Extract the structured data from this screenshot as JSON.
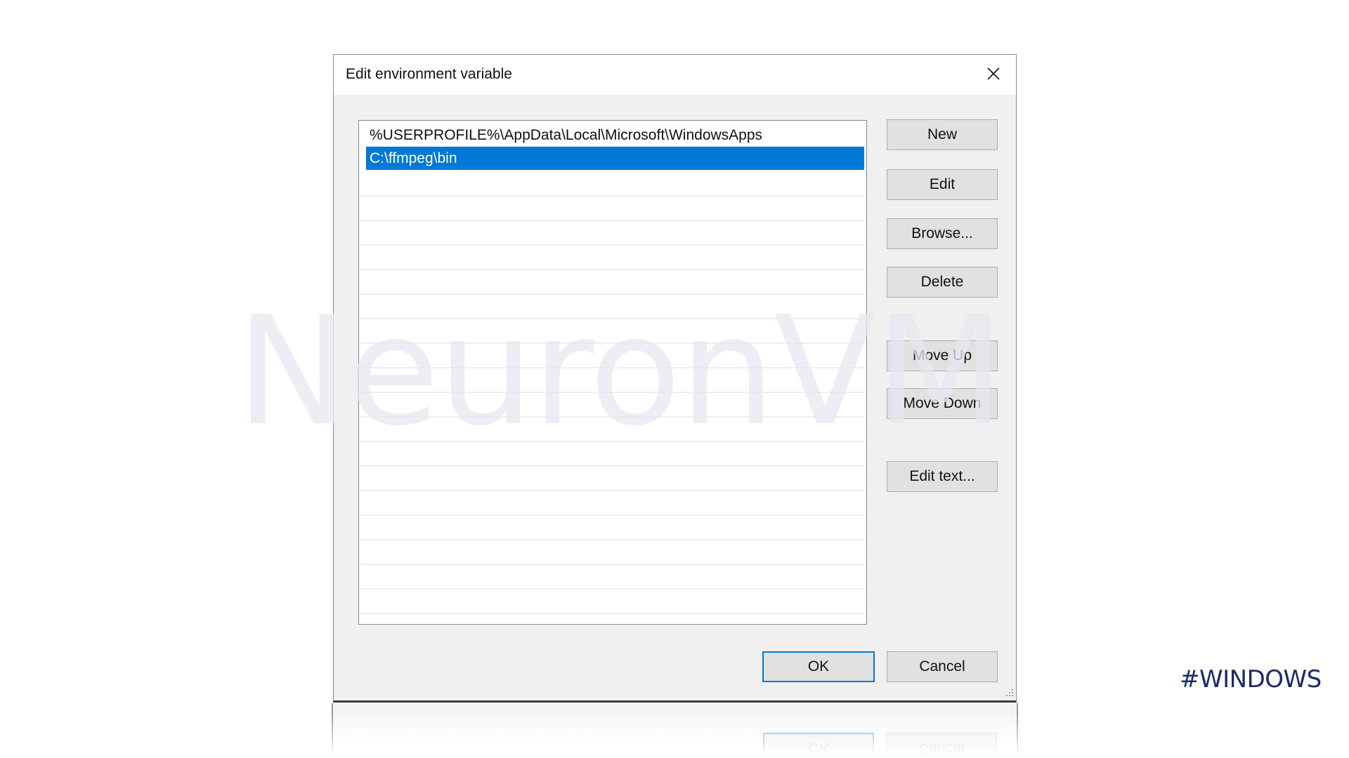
{
  "dialog": {
    "title": "Edit environment variable",
    "close_icon": "close-icon",
    "list_items": [
      {
        "label": "%USERPROFILE%\\AppData\\Local\\Microsoft\\WindowsApps",
        "selected": false
      },
      {
        "label": "C:\\ffmpeg\\bin",
        "selected": true
      }
    ],
    "side_buttons": {
      "new": "New",
      "edit": "Edit",
      "browse": "Browse...",
      "delete": "Delete",
      "move_up": "Move Up",
      "move_down": "Move Down",
      "edit_text": "Edit text..."
    },
    "footer_buttons": {
      "ok": "OK",
      "cancel": "Cancel"
    },
    "resize_grip_icon": "resize-grip-icon"
  },
  "colors": {
    "selection": "#0078d7",
    "default_button_border": "#0078d7",
    "hashtag": "#1e2a68"
  },
  "overlay": {
    "watermark": "NeuronVM",
    "hashtag": "#WINDOWS"
  }
}
